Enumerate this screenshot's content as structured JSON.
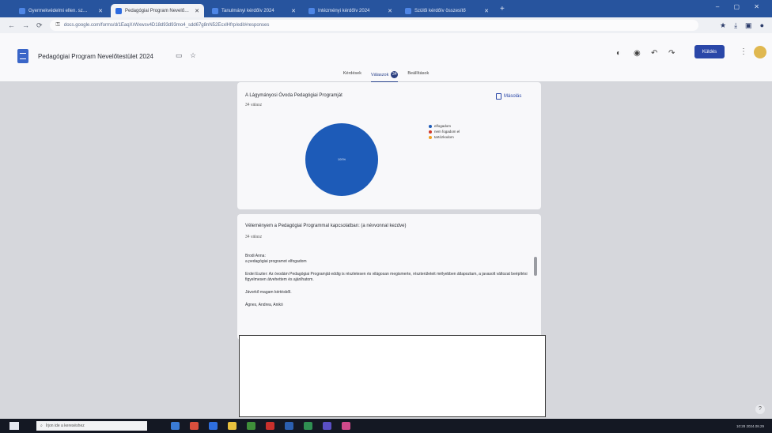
{
  "browser": {
    "tabs": [
      {
        "label": "Gyermekvédelmi ellen. sz…",
        "active": false
      },
      {
        "label": "Pedagógiai Program Nevelő…",
        "active": true
      },
      {
        "label": "Tanulmányi kérdőív 2024",
        "active": false
      },
      {
        "label": "Intézményi kérdőív 2024",
        "active": false
      },
      {
        "label": "Szülői kérdőív összesítő",
        "active": false
      }
    ],
    "url": "docs.google.com/forms/d/1EaqXrWxwsv4D18d93d93mo4_sdd67g8nN52EcxlHfrp/edit#responses"
  },
  "form": {
    "title": "Pedagógiai Program Nevelőtestület 2024",
    "send_label": "Küldés",
    "tabs": {
      "questions": "Kérdések",
      "responses": "Válaszok",
      "settings": "Beállítások",
      "response_count": "34"
    }
  },
  "question1": {
    "title": "A Lágymányosi Óvoda Pedagógiai Programját",
    "count": "34 válasz",
    "copy_label": "Másolás",
    "pie_label": "100%",
    "legend": [
      {
        "label": "elfogadom",
        "color": "#1d5bb8"
      },
      {
        "label": "nem fogadom el",
        "color": "#d0382b"
      },
      {
        "label": "tartózkodom",
        "color": "#f0a020"
      }
    ],
    "values": [
      34,
      0,
      0
    ]
  },
  "question2": {
    "title": "Véleményem a Pedagógiai Programmal kapcsolatban: (a névvonnal kezdve)",
    "count": "34 válasz",
    "responses": [
      "Brodi Anna:\na pedagógiai programot elfogadom",
      "Erdei Eszter: Az óvodám Pedagógiai Programját eddig is részletesen és világosan megismerte, részterületeit mélyebben átlapoztam, a javasolt változat beépítési figyelmesen átvehettem és ajánlhatom.",
      "Jávorkő magam kértésből.",
      "Ágnes, Andrea, Anikó"
    ]
  },
  "taskbar": {
    "search_placeholder": "Írjon ide a kereséshez",
    "clock": "10:28 2024.08.29"
  }
}
